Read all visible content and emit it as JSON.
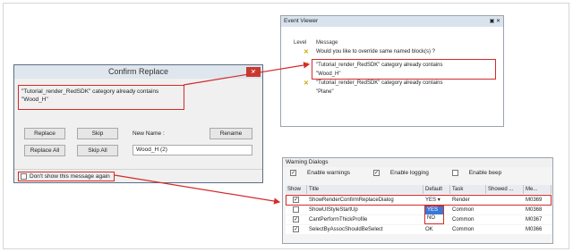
{
  "confirm_replace": {
    "title": "Confirm Replace",
    "close": "✕",
    "message_line1": "\"Tutorial_render_RedSDK\" category already contains",
    "message_line2": "\"Wood_H\"",
    "replace": "Replace",
    "skip": "Skip",
    "new_name_label": "New Name :",
    "rename": "Rename",
    "replace_all": "Replace All",
    "skip_all": "Skip All",
    "new_name_value": "Wood_H (2)",
    "dont_show": "Don't show this message again"
  },
  "event_viewer": {
    "title": "Event Viewer",
    "title_icons": "▣ ✕",
    "col_level": "Level",
    "col_message": "Message",
    "rows": [
      {
        "line1": "Would you like to override same named block(s) ?",
        "line2": ""
      },
      {
        "line1": "\"Tutorial_render_RedSDK\" category already contains",
        "line2": "\"Wood_H\""
      },
      {
        "line1": "\"Tutorial_render_RedSDK\" category already contains",
        "line2": "\"Plane\""
      }
    ]
  },
  "warning_dialogs": {
    "title": "Warning Dialogs",
    "enable_warnings": "Enable warnings",
    "enable_logging": "Enable logging",
    "enable_beep": "Enable beep",
    "headers": [
      "Show",
      "Title",
      "Default",
      "Task",
      "Showed ...",
      "Me..."
    ],
    "rows": [
      {
        "show": "✓",
        "title": "ShowRenderConfirmReplaceDialog",
        "default": "YES",
        "task": "Render",
        "showed": "",
        "me": "M0369"
      },
      {
        "show": "",
        "title": "ShowUIStyleStartUp",
        "default": "",
        "task": "Common",
        "showed": "",
        "me": "M0368"
      },
      {
        "show": "✓",
        "title": "CantPerformThickProfile",
        "default": "YES",
        "task": "Common",
        "showed": "",
        "me": "M0367"
      },
      {
        "show": "✓",
        "title": "SelectByAssocShouldBeSelect",
        "default": "OK",
        "task": "Common",
        "showed": "",
        "me": "M0366"
      }
    ],
    "dropdown_options": [
      "YES",
      "NO"
    ]
  },
  "colors": {
    "highlight": "#d42b2b",
    "warning": "#caa400",
    "title_bar": "#dfe6ee"
  }
}
